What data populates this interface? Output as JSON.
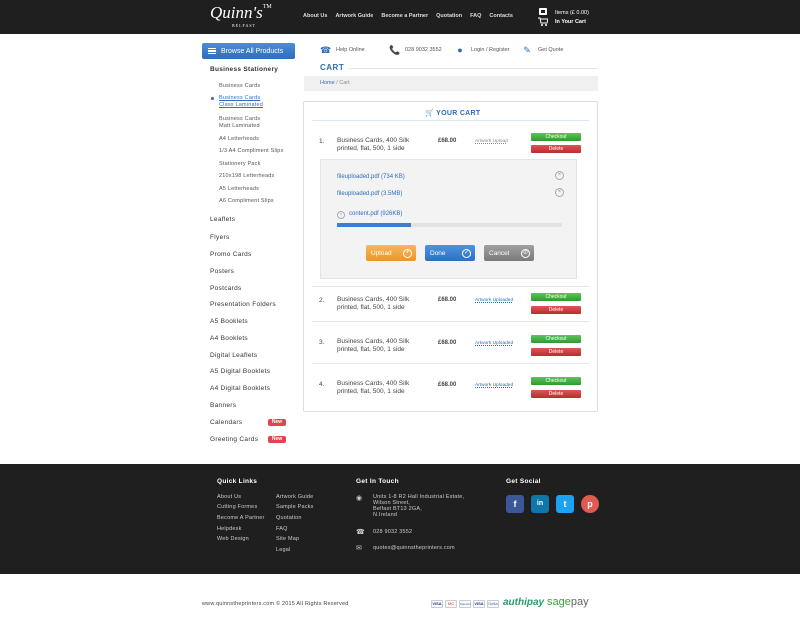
{
  "header": {
    "logo_text": "Quinn's",
    "logo_tm": "TM",
    "logo_sub": "BELFAST",
    "nav": [
      "About Us",
      "Artwork Guide",
      "Become a Partner",
      "Quotation",
      "FAQ",
      "Contacts"
    ],
    "cart_items": "Items (£ 0.00)",
    "cart_label": "In Your Cart"
  },
  "sidebar": {
    "browse_label": "Browse All Products",
    "category_heading": "Business Stationery",
    "sub_items": [
      "Business Cards",
      "Business Cards\nClass Laminated",
      "Business Cards\nMatt Laminated",
      "A4 Letterheads",
      "1/3 A4 Compliment Slips",
      "Stationery Pack",
      "210x198 Letterheads",
      "A5 Letterheads",
      "A6 Compliment Slips"
    ],
    "active_sub_index": 1,
    "categories": [
      "Leaflets",
      "Flyers",
      "Promo Cards",
      "Posters",
      "Postcards",
      "Presentation Folders",
      "A5 Booklets",
      "A4 Booklets",
      "Digital Leaflets",
      "A5 Digital Booklets",
      "A4 Digital Booklets",
      "Banners",
      "Calendars",
      "Greeting Cards"
    ],
    "new_badge": "New"
  },
  "toplinks": {
    "help": "Help Online",
    "phone": "028 9032 3552",
    "login": "Login / Register",
    "quote": "Get Quote"
  },
  "page": {
    "title": "CART",
    "breadcrumb_home": "Home",
    "breadcrumb_sep": "/",
    "breadcrumb_current": "Cart",
    "cart_heading": "YOUR CART"
  },
  "cart": {
    "rows": [
      {
        "num": "1.",
        "desc": "Business Cards, 400 Silk printed, flat, 500, 1 side",
        "price": "£68.00",
        "artwork": "Artwork Upload"
      },
      {
        "num": "2.",
        "desc": "Business Cards, 400 Silk printed, flat, 500, 1 side",
        "price": "£68.00",
        "artwork": "Artwork Uploaded"
      },
      {
        "num": "3.",
        "desc": "Business Cards, 400 Silk printed, flat, 500, 1 side",
        "price": "£68.00",
        "artwork": "Artwork Uploaded"
      },
      {
        "num": "4.",
        "desc": "Business Cards, 400 Silk printed, flat, 500, 1 side",
        "price": "£68.00",
        "artwork": "Artwork Uploaded"
      }
    ],
    "checkout_label": "Checkout",
    "delete_label": "Delete"
  },
  "upload": {
    "files": [
      "fileuploaded.pdf (734 KB)",
      "fileuploaded.pdf (3.5MB)"
    ],
    "in_progress_file": "content.pdf (926KB)",
    "progress": 0.33,
    "upload_label": "Upload",
    "done_label": "Done",
    "cancel_label": "Cancel"
  },
  "footer": {
    "quick_links_title": "Quick Links",
    "quick_links_col1": [
      "About Us",
      "Cutting Formes",
      "Become A Partner",
      "Helpdesk",
      "Web Design"
    ],
    "quick_links_col2": [
      "Artwork Guide",
      "Sample Packs",
      "Quotation",
      "FAQ",
      "Site Map",
      "Legal"
    ],
    "get_in_touch_title": "Get In Touch",
    "address_lines": [
      "Units 1-8 R2 Hall Industrial Estate,",
      "Wilson Street,",
      "Belfast BT13 2GA,",
      "N.Ireland"
    ],
    "phone": "028 9032 3552",
    "email": "quotes@quinnstheprinters.com",
    "social_title": "Get Social",
    "social": [
      "f",
      "in",
      "t",
      "p"
    ],
    "copyright": "www.quinnstheprinters.com © 2015 All Rights Reserved",
    "payments": [
      "VISA",
      "MC",
      "Maestro",
      "VISA",
      "Delta"
    ],
    "authipay": "authipay",
    "sagepay_1": "sage",
    "sagepay_2": "pay"
  },
  "colors": {
    "accent": "#2f6db8",
    "header_bg": "#1f1f1f",
    "checkout": "#3aa83a",
    "delete": "#c93a3a",
    "upload": "#f0a53a",
    "done": "#3a7fd0",
    "cancel": "#8a8a8a",
    "new_badge": "#e0454f"
  }
}
